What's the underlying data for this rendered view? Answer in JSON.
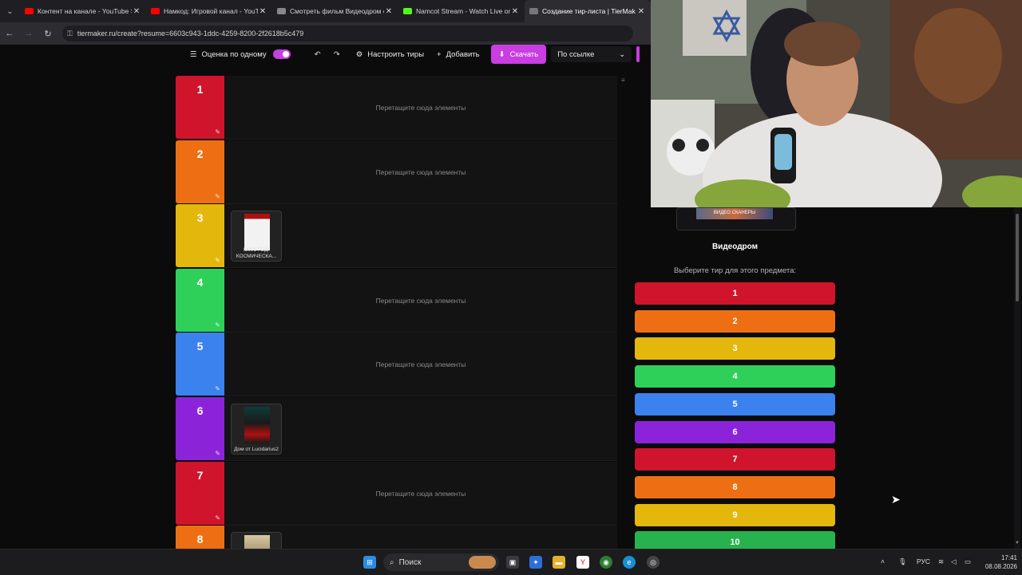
{
  "browser": {
    "tabs": [
      {
        "title": "Контент на канале - YouTube S",
        "favicon_color": "#ff0000",
        "active": false
      },
      {
        "title": "Намкод: Игровой канал - YouT",
        "favicon_color": "#ff0000",
        "active": false
      },
      {
        "title": "Смотреть фильм Видеодром о",
        "favicon_color": "#888888",
        "active": false
      },
      {
        "title": "Namcot Stream - Watch Live on",
        "favicon_color": "#53fc18",
        "active": false
      },
      {
        "title": "Создание тир-листа | TierMak",
        "favicon_color": "#777777",
        "active": true
      }
    ],
    "url": "tiermaker.ru/create?resume=6603c943-1ddc-4259-8200-2f2618b5c479"
  },
  "toolbar": {
    "one_by_one_label": "Оценка по одному",
    "one_by_one_enabled": true,
    "configure_tiers_label": "Настроить тиры",
    "add_label": "Добавить",
    "download_label": "Скачать",
    "share_select_value": "По ссылке"
  },
  "tiers": [
    {
      "label": "1",
      "color": "#d0142c",
      "items": [],
      "placeholder": "Перетащите сюда элементы"
    },
    {
      "label": "2",
      "color": "#ee6f13",
      "items": [],
      "placeholder": "Перетащите сюда элементы"
    },
    {
      "label": "3",
      "color": "#e4b70c",
      "items": [
        {
          "caption": "I2001 ГОД: КОСМИЧЕСКА..."
        }
      ],
      "placeholder": ""
    },
    {
      "label": "4",
      "color": "#2fd05a",
      "items": [],
      "placeholder": "Перетащите сюда элементы"
    },
    {
      "label": "5",
      "color": "#3b82ee",
      "items": [],
      "placeholder": "Перетащите сюда элементы"
    },
    {
      "label": "6",
      "color": "#8b24d9",
      "items": [
        {
          "caption": "Дом от Lucidarius2"
        }
      ],
      "placeholder": ""
    },
    {
      "label": "7",
      "color": "#d0142c",
      "items": [],
      "placeholder": "Перетащите сюда элементы"
    },
    {
      "label": "8",
      "color": "#ee6f13",
      "items": [
        {
          "caption": ""
        }
      ],
      "placeholder": ""
    }
  ],
  "panel": {
    "item_title": "Видеодром",
    "hint": "Выберите тир для этого предмета:",
    "preview_text": "ВИДЕО СКАНЕРЫ",
    "choices": [
      {
        "label": "1",
        "color": "#d0142c"
      },
      {
        "label": "2",
        "color": "#ee6f13"
      },
      {
        "label": "3",
        "color": "#e4b70c"
      },
      {
        "label": "4",
        "color": "#2fd05a"
      },
      {
        "label": "5",
        "color": "#3b82ee"
      },
      {
        "label": "6",
        "color": "#8b24d9"
      },
      {
        "label": "7",
        "color": "#d0142c"
      },
      {
        "label": "8",
        "color": "#ee6f13"
      },
      {
        "label": "9",
        "color": "#e4b70c"
      },
      {
        "label": "10",
        "color": "#27b24e"
      }
    ]
  },
  "taskbar": {
    "search_label": "Поиск",
    "language": "РУС",
    "time": "17:41",
    "date": "08.08.2026"
  },
  "icons": [
    "chevron-down-icon",
    "back-arrow-icon",
    "forward-arrow-icon",
    "reload-icon",
    "lock-icon",
    "list-icon",
    "undo-icon",
    "redo-icon",
    "sliders-icon",
    "plus-icon",
    "download-icon",
    "pencil-icon",
    "windows-start-icon",
    "search-icon"
  ]
}
